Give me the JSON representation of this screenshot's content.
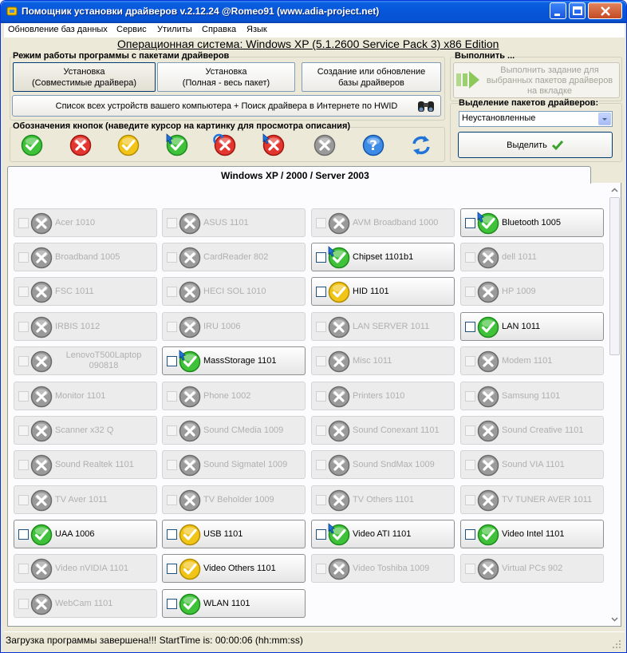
{
  "window": {
    "title": "Помощник установки драйверов v.2.12.24 @Romeo91 (www.adia-project.net)"
  },
  "menu": [
    "Обновление баз данных",
    "Сервис",
    "Утилиты",
    "Справка",
    "Язык"
  ],
  "os_line": "Операционная система: Windows XP  (5.1.2600 Service Pack 3) x86 Edition",
  "mode_group": {
    "label": "Режим работы программы с пакетами драйверов",
    "buttons": [
      {
        "line1": "Установка",
        "line2": "(Совместимые драйвера)",
        "active": true
      },
      {
        "line1": "Установка",
        "line2": "(Полная - весь пакет)",
        "active": false
      },
      {
        "line1": "Создание или обновление",
        "line2": "базы драйверов",
        "active": false
      }
    ],
    "device_list_button": "Список всех устройств вашего компьютера + Поиск драйвера в Интернете по HWID"
  },
  "legend": {
    "label": "Обозначения кнопок (наведите курсор на картинку для просмотра описания)",
    "icons": [
      "check-green-icon",
      "cross-red-icon",
      "check-yellow-icon",
      "check-green-update-icon",
      "cross-red-refresh-icon",
      "cross-red-update-icon",
      "cross-gray-icon",
      "help-icon",
      "refresh-arrows-icon"
    ]
  },
  "execute": {
    "label": "Выполнить ...",
    "button": "Выполнить задание для выбранных пакетов драйверов на вкладке"
  },
  "selection": {
    "label": "Выделение пакетов драйверов:",
    "selected": "Неустановленные",
    "button": "Выделить"
  },
  "tab": {
    "label": "Windows XP / 2000 / Server 2003"
  },
  "packages": [
    {
      "name": "Acer 1010",
      "status": "gray"
    },
    {
      "name": "ASUS 1101",
      "status": "gray"
    },
    {
      "name": "AVM Broadband 1000",
      "status": "gray"
    },
    {
      "name": "Bluetooth 1005",
      "status": "green-update"
    },
    {
      "name": "Broadband 1005",
      "status": "gray"
    },
    {
      "name": "CardReader 802",
      "status": "gray"
    },
    {
      "name": "Chipset 1101b1",
      "status": "green-update"
    },
    {
      "name": "dell 1011",
      "status": "gray"
    },
    {
      "name": "FSC 1011",
      "status": "gray"
    },
    {
      "name": "HECI SOL 1010",
      "status": "gray"
    },
    {
      "name": "HID 1101",
      "status": "yellow"
    },
    {
      "name": "HP 1009",
      "status": "gray"
    },
    {
      "name": "IRBIS 1012",
      "status": "gray"
    },
    {
      "name": "IRU 1006",
      "status": "gray"
    },
    {
      "name": "LAN SERVER 1011",
      "status": "gray"
    },
    {
      "name": "LAN 1011",
      "status": "green"
    },
    {
      "name": "LenovoT500Laptop 090818",
      "status": "gray"
    },
    {
      "name": "MassStorage 1101",
      "status": "green-update"
    },
    {
      "name": "Misc 1011",
      "status": "gray"
    },
    {
      "name": "Modem 1101",
      "status": "gray"
    },
    {
      "name": "Monitor 1101",
      "status": "gray"
    },
    {
      "name": "Phone 1002",
      "status": "gray"
    },
    {
      "name": "Printers 1010",
      "status": "gray"
    },
    {
      "name": "Samsung 1101",
      "status": "gray"
    },
    {
      "name": "Scanner x32 Q",
      "status": "gray"
    },
    {
      "name": "Sound CMedia 1009",
      "status": "gray"
    },
    {
      "name": "Sound Conexant 1101",
      "status": "gray"
    },
    {
      "name": "Sound Creative 1101",
      "status": "gray"
    },
    {
      "name": "Sound Realtek 1101",
      "status": "gray"
    },
    {
      "name": "Sound Sigmatel 1009",
      "status": "gray"
    },
    {
      "name": "Sound SndMax 1009",
      "status": "gray"
    },
    {
      "name": "Sound VIA 1101",
      "status": "gray"
    },
    {
      "name": "TV Aver 1011",
      "status": "gray"
    },
    {
      "name": "TV Beholder 1009",
      "status": "gray"
    },
    {
      "name": "TV Others 1101",
      "status": "gray"
    },
    {
      "name": "TV TUNER AVER 1011",
      "status": "gray"
    },
    {
      "name": "UAA 1006",
      "status": "green"
    },
    {
      "name": "USB 1101",
      "status": "yellow"
    },
    {
      "name": "Video ATI 1101",
      "status": "green-update"
    },
    {
      "name": "Video Intel 1101",
      "status": "green"
    },
    {
      "name": "Video nVIDIA 1101",
      "status": "gray"
    },
    {
      "name": "Video Others 1101",
      "status": "yellow"
    },
    {
      "name": "Video Toshiba 1009",
      "status": "gray"
    },
    {
      "name": "Virtual PCs 902",
      "status": "gray"
    },
    {
      "name": "WebCam 1101",
      "status": "gray"
    },
    {
      "name": "WLAN 1101",
      "status": "green"
    }
  ],
  "status_bar": "Загрузка программы завершена!!! StartTime is: 00:00:06 (hh:mm:ss)"
}
